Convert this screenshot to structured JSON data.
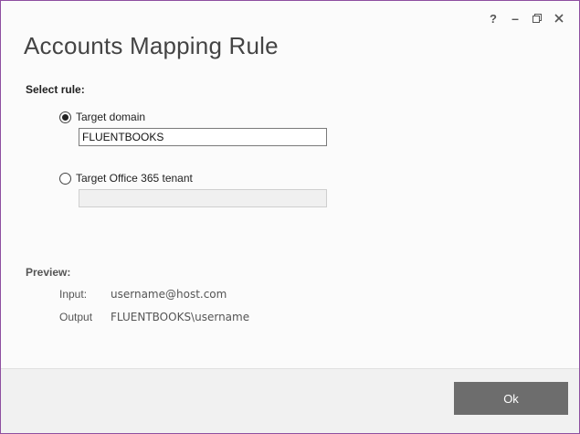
{
  "window": {
    "title": "Accounts Mapping Rule",
    "controls": {
      "help": "?",
      "minimize": "–",
      "restore": "restore",
      "close": "close"
    }
  },
  "select_rule": {
    "label": "Select rule:",
    "options": [
      {
        "label": "Target domain",
        "selected": true,
        "value": "FLUENTBOOKS",
        "placeholder": ""
      },
      {
        "label": "Target Office 365 tenant",
        "selected": false,
        "value": "",
        "placeholder": ""
      }
    ]
  },
  "preview": {
    "label": "Preview:",
    "input_key": "Input:",
    "input_value": "username@host.com",
    "output_key": "Output",
    "output_value": "FLUENTBOOKS\\username"
  },
  "footer": {
    "ok_label": "Ok"
  },
  "colors": {
    "border": "#8e4fa0",
    "ok_button": "#6d6d6d",
    "footer_bg": "#f1f1f1"
  }
}
